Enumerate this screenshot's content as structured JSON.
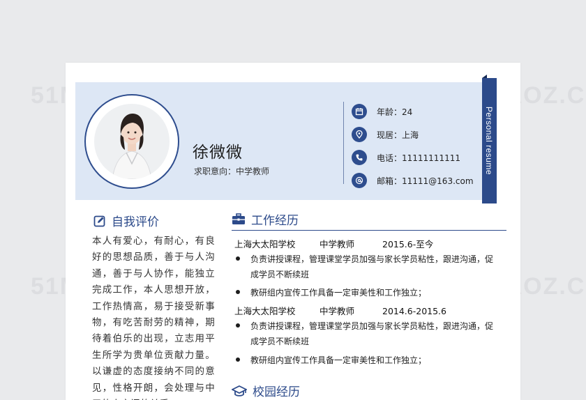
{
  "watermark": "51MIAOZ.COM",
  "profile": {
    "name": "徐微微",
    "job_intent": "求职意向：中学教师",
    "tab_label": "Personal resume",
    "info": [
      {
        "icon": "calendar-icon",
        "text": "年龄：24"
      },
      {
        "icon": "location-pin-icon",
        "text": "现居：上海"
      },
      {
        "icon": "phone-icon",
        "text": "电话：11111111111"
      },
      {
        "icon": "email-icon",
        "text": "邮箱：11111@163.com"
      }
    ]
  },
  "self_evaluation": {
    "title": "自我评价",
    "icon": "edit-icon",
    "text": "本人有爱心，有耐心，有良好的思想品质，善于与人沟通，善于与人协作，能独立完成工作，本人思想开放，工作热情高，易于接受新事物，有吃苦耐劳的精神，期待着伯乐的出现，立志用平生所学为贵单位贡献力量。以谦虚的态度接纳不同的意见，性格开朗，会处理与中卫的人之间的关系。"
  },
  "work_experience": {
    "title": "工作经历",
    "icon": "briefcase-icon",
    "entries": [
      {
        "school": "上海大太阳学校",
        "position": "中学教师",
        "period": "2015.6-至今",
        "bullets": [
          "负责讲授课程，管理课堂学员加强与家长学员粘性，跟进沟通，促成学员不断续班",
          "教研组内宣传工作具备一定审美性和工作独立；"
        ]
      },
      {
        "school": "上海大太阳学校",
        "position": "中学教师",
        "period": "2014.6-2015.6",
        "bullets": [
          "负责讲授课程，管理课堂学员加强与家长学员粘性，跟进沟通，促成学员不断续班",
          "教研组内宣传工作具备一定审美性和工作独立；"
        ]
      }
    ]
  },
  "campus_experience": {
    "title": "校园经历",
    "icon": "graduation-cap-icon"
  },
  "colors": {
    "accent": "#2c4a8a",
    "header_band": "#dde7f5",
    "page": "#ffffff",
    "background": "#e9eaec"
  }
}
